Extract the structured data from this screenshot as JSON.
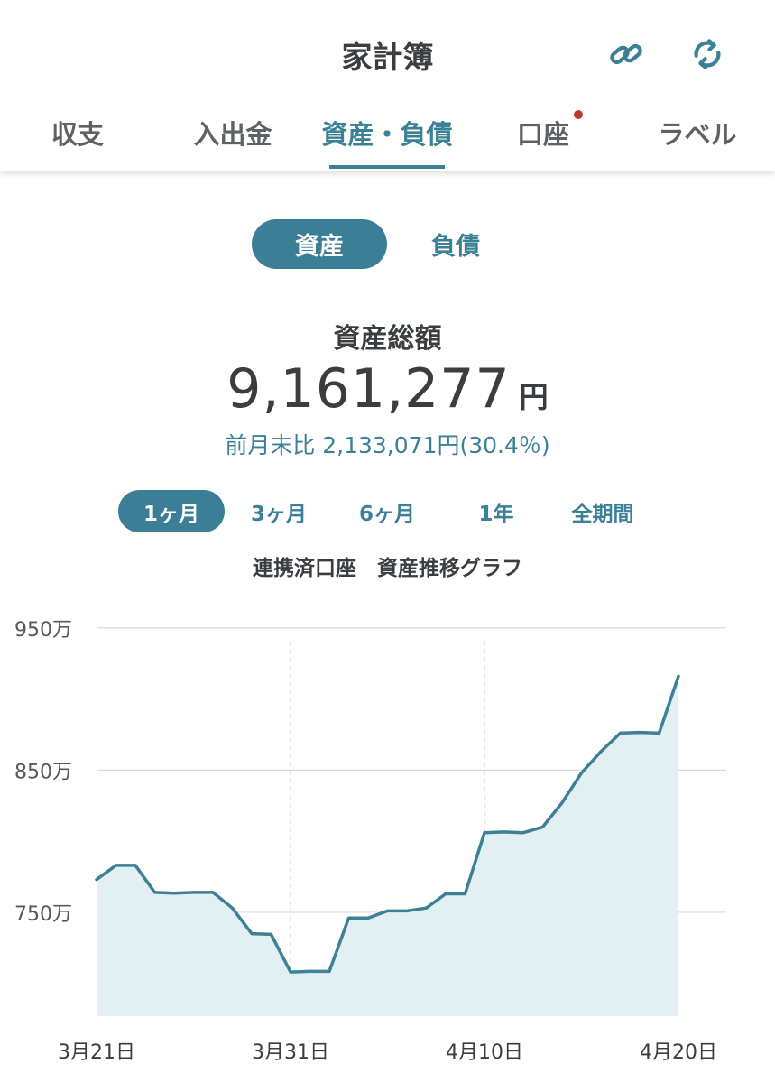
{
  "header": {
    "title": "家計簿",
    "link_icon": "link-icon",
    "sync_icon": "sync-icon"
  },
  "tabs": [
    {
      "label": "収支",
      "active": false
    },
    {
      "label": "入出金",
      "active": false
    },
    {
      "label": "資産・負債",
      "active": true
    },
    {
      "label": "口座",
      "active": false,
      "badge": true
    },
    {
      "label": "ラベル",
      "active": false
    }
  ],
  "segment": {
    "asset": "資産",
    "liability": "負債",
    "selected": "資産"
  },
  "summary": {
    "label": "資産総額",
    "amount": "9,161,277",
    "unit": "円",
    "delta": "前月末比 2,133,071円(30.4％)"
  },
  "periods": [
    {
      "label": "1ヶ月",
      "active": true
    },
    {
      "label": "3ヶ月",
      "active": false
    },
    {
      "label": "6ヶ月",
      "active": false
    },
    {
      "label": "1年",
      "active": false
    },
    {
      "label": "全期間",
      "active": false
    }
  ],
  "graph_title": "連携済口座　資産推移グラフ",
  "colors": {
    "accent": "#3a8097",
    "line": "#3d8196",
    "fill": "#e3f0f3",
    "badge": "#c0392b"
  },
  "chart_data": {
    "type": "area",
    "title": "連携済口座　資産推移グラフ",
    "xlabel": "",
    "ylabel": "",
    "ylim": [
      677,
      960
    ],
    "yticks": [
      {
        "value": 950,
        "label": "950万"
      },
      {
        "value": 850,
        "label": "850万"
      },
      {
        "value": 750,
        "label": "750万"
      }
    ],
    "xticks": [
      {
        "day": 0,
        "label": "3月21日"
      },
      {
        "day": 10,
        "label": "3月31日"
      },
      {
        "day": 20,
        "label": "4月10日"
      },
      {
        "day": 30,
        "label": "4月20日"
      }
    ],
    "series": [
      {
        "unit": "万円",
        "points": [
          [
            0,
            773
          ],
          [
            1,
            783
          ],
          [
            2,
            783
          ],
          [
            3,
            764
          ],
          [
            4,
            763.5
          ],
          [
            5,
            764
          ],
          [
            6,
            764
          ],
          [
            7,
            753
          ],
          [
            8,
            735
          ],
          [
            9,
            734.5
          ],
          [
            10,
            708
          ],
          [
            11,
            708.5
          ],
          [
            12,
            708.5
          ],
          [
            13,
            746
          ],
          [
            14,
            746
          ],
          [
            15,
            751
          ],
          [
            16,
            751
          ],
          [
            17,
            753
          ],
          [
            18,
            763
          ],
          [
            19,
            763
          ],
          [
            20,
            806
          ],
          [
            21,
            806.5
          ],
          [
            22,
            806
          ],
          [
            23,
            810
          ],
          [
            24,
            827
          ],
          [
            25,
            848
          ],
          [
            26,
            863
          ],
          [
            27,
            876
          ],
          [
            28,
            876.5
          ],
          [
            29,
            876
          ],
          [
            30,
            916
          ]
        ]
      }
    ]
  }
}
